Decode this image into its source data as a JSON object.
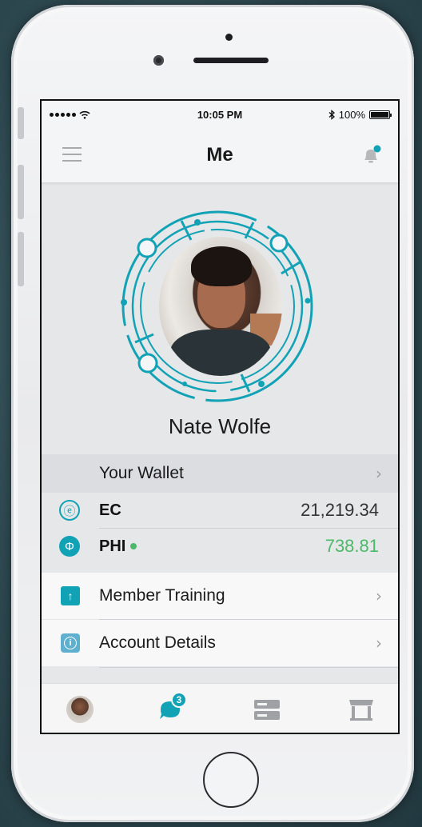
{
  "status_bar": {
    "time": "10:05 PM",
    "battery": "100%",
    "battery_level": 1.0,
    "icons": [
      "signal-dots",
      "wifi-icon",
      "bluetooth-icon",
      "battery-icon"
    ]
  },
  "header": {
    "title": "Me",
    "menu_icon": "hamburger-icon",
    "notification_icon": "bell-icon",
    "notification_dot": true
  },
  "profile": {
    "name": "Nate Wolfe"
  },
  "wallet": {
    "header": "Your Wallet",
    "coins": [
      {
        "symbol": "ⓔ",
        "label": "EC",
        "value": "21,219.34",
        "icon": "ec-coin-icon",
        "value_color": "#333333"
      },
      {
        "symbol": "Φ",
        "label": "PHI",
        "value": "738.81",
        "icon": "phi-coin-icon",
        "online": true,
        "value_color": "#4cb86a"
      }
    ]
  },
  "menu": [
    {
      "label": "Member Training",
      "icon": "upload-arrow-icon",
      "glyph": "↑",
      "icon_color": "#12a2b5"
    },
    {
      "label": "Account Details",
      "icon": "info-icon",
      "glyph": "i",
      "icon_color": "#5fb0cf"
    }
  ],
  "tabbar": {
    "tabs": [
      {
        "name": "profile-tab",
        "icon": "avatar"
      },
      {
        "name": "messages-tab",
        "icon": "chat-bubble-icon",
        "badge": "3"
      },
      {
        "name": "feed-tab",
        "icon": "list-icon"
      },
      {
        "name": "market-tab",
        "icon": "store-icon"
      }
    ]
  },
  "colors": {
    "accent": "#12a2b5",
    "positive": "#4cb86a"
  }
}
